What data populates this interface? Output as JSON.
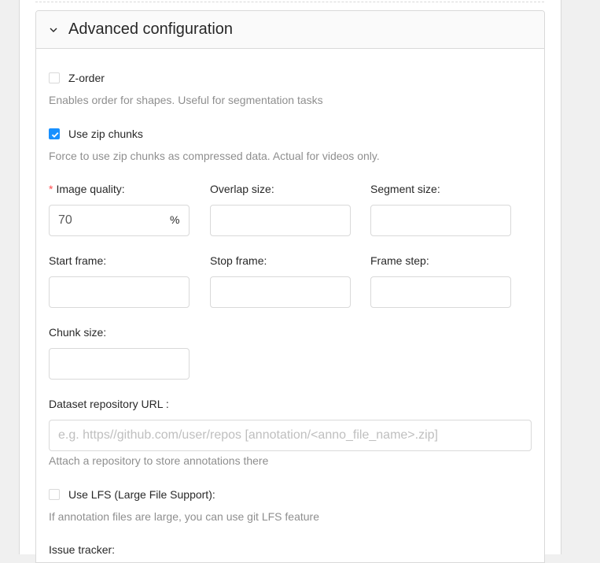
{
  "panel": {
    "title": "Advanced configuration"
  },
  "z_order": {
    "label": "Z-order",
    "checked": false,
    "help": "Enables order for shapes. Useful for segmentation tasks"
  },
  "zip_chunks": {
    "label": "Use zip chunks",
    "checked": true,
    "help": "Force to use zip chunks as compressed data. Actual for videos only."
  },
  "fields": {
    "image_quality": {
      "label": "Image quality",
      "value": "70",
      "suffix": "%",
      "required": "*"
    },
    "overlap_size": {
      "label": "Overlap size",
      "value": ""
    },
    "segment_size": {
      "label": "Segment size",
      "value": ""
    },
    "start_frame": {
      "label": "Start frame",
      "value": ""
    },
    "stop_frame": {
      "label": "Stop frame",
      "value": ""
    },
    "frame_step": {
      "label": "Frame step",
      "value": ""
    },
    "chunk_size": {
      "label": "Chunk size",
      "value": ""
    }
  },
  "label_colon": ":",
  "repo": {
    "label": "Dataset repository URL",
    "placeholder": "e.g. https//github.com/user/repos [annotation/<anno_file_name>.zip]",
    "help": "Attach a repository to store annotations there"
  },
  "lfs": {
    "label": "Use LFS (Large File Support):",
    "checked": false,
    "help": "If annotation files are large, you can use git LFS feature"
  },
  "issue_tracker": {
    "label": "Issue tracker"
  },
  "colors": {
    "primary": "#1890ff",
    "required": "#ff4d4f"
  }
}
